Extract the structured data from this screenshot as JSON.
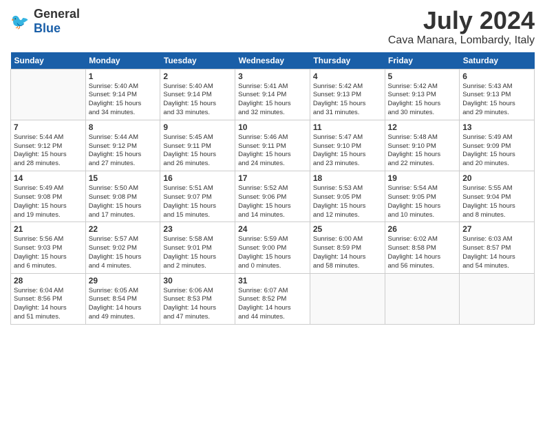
{
  "logo": {
    "general": "General",
    "blue": "Blue"
  },
  "title": {
    "month_year": "July 2024",
    "location": "Cava Manara, Lombardy, Italy"
  },
  "days_of_week": [
    "Sunday",
    "Monday",
    "Tuesday",
    "Wednesday",
    "Thursday",
    "Friday",
    "Saturday"
  ],
  "weeks": [
    [
      {
        "day": "",
        "info": ""
      },
      {
        "day": "1",
        "info": "Sunrise: 5:40 AM\nSunset: 9:14 PM\nDaylight: 15 hours\nand 34 minutes."
      },
      {
        "day": "2",
        "info": "Sunrise: 5:40 AM\nSunset: 9:14 PM\nDaylight: 15 hours\nand 33 minutes."
      },
      {
        "day": "3",
        "info": "Sunrise: 5:41 AM\nSunset: 9:14 PM\nDaylight: 15 hours\nand 32 minutes."
      },
      {
        "day": "4",
        "info": "Sunrise: 5:42 AM\nSunset: 9:13 PM\nDaylight: 15 hours\nand 31 minutes."
      },
      {
        "day": "5",
        "info": "Sunrise: 5:42 AM\nSunset: 9:13 PM\nDaylight: 15 hours\nand 30 minutes."
      },
      {
        "day": "6",
        "info": "Sunrise: 5:43 AM\nSunset: 9:13 PM\nDaylight: 15 hours\nand 29 minutes."
      }
    ],
    [
      {
        "day": "7",
        "info": "Sunrise: 5:44 AM\nSunset: 9:12 PM\nDaylight: 15 hours\nand 28 minutes."
      },
      {
        "day": "8",
        "info": "Sunrise: 5:44 AM\nSunset: 9:12 PM\nDaylight: 15 hours\nand 27 minutes."
      },
      {
        "day": "9",
        "info": "Sunrise: 5:45 AM\nSunset: 9:11 PM\nDaylight: 15 hours\nand 26 minutes."
      },
      {
        "day": "10",
        "info": "Sunrise: 5:46 AM\nSunset: 9:11 PM\nDaylight: 15 hours\nand 24 minutes."
      },
      {
        "day": "11",
        "info": "Sunrise: 5:47 AM\nSunset: 9:10 PM\nDaylight: 15 hours\nand 23 minutes."
      },
      {
        "day": "12",
        "info": "Sunrise: 5:48 AM\nSunset: 9:10 PM\nDaylight: 15 hours\nand 22 minutes."
      },
      {
        "day": "13",
        "info": "Sunrise: 5:49 AM\nSunset: 9:09 PM\nDaylight: 15 hours\nand 20 minutes."
      }
    ],
    [
      {
        "day": "14",
        "info": "Sunrise: 5:49 AM\nSunset: 9:08 PM\nDaylight: 15 hours\nand 19 minutes."
      },
      {
        "day": "15",
        "info": "Sunrise: 5:50 AM\nSunset: 9:08 PM\nDaylight: 15 hours\nand 17 minutes."
      },
      {
        "day": "16",
        "info": "Sunrise: 5:51 AM\nSunset: 9:07 PM\nDaylight: 15 hours\nand 15 minutes."
      },
      {
        "day": "17",
        "info": "Sunrise: 5:52 AM\nSunset: 9:06 PM\nDaylight: 15 hours\nand 14 minutes."
      },
      {
        "day": "18",
        "info": "Sunrise: 5:53 AM\nSunset: 9:05 PM\nDaylight: 15 hours\nand 12 minutes."
      },
      {
        "day": "19",
        "info": "Sunrise: 5:54 AM\nSunset: 9:05 PM\nDaylight: 15 hours\nand 10 minutes."
      },
      {
        "day": "20",
        "info": "Sunrise: 5:55 AM\nSunset: 9:04 PM\nDaylight: 15 hours\nand 8 minutes."
      }
    ],
    [
      {
        "day": "21",
        "info": "Sunrise: 5:56 AM\nSunset: 9:03 PM\nDaylight: 15 hours\nand 6 minutes."
      },
      {
        "day": "22",
        "info": "Sunrise: 5:57 AM\nSunset: 9:02 PM\nDaylight: 15 hours\nand 4 minutes."
      },
      {
        "day": "23",
        "info": "Sunrise: 5:58 AM\nSunset: 9:01 PM\nDaylight: 15 hours\nand 2 minutes."
      },
      {
        "day": "24",
        "info": "Sunrise: 5:59 AM\nSunset: 9:00 PM\nDaylight: 15 hours\nand 0 minutes."
      },
      {
        "day": "25",
        "info": "Sunrise: 6:00 AM\nSunset: 8:59 PM\nDaylight: 14 hours\nand 58 minutes."
      },
      {
        "day": "26",
        "info": "Sunrise: 6:02 AM\nSunset: 8:58 PM\nDaylight: 14 hours\nand 56 minutes."
      },
      {
        "day": "27",
        "info": "Sunrise: 6:03 AM\nSunset: 8:57 PM\nDaylight: 14 hours\nand 54 minutes."
      }
    ],
    [
      {
        "day": "28",
        "info": "Sunrise: 6:04 AM\nSunset: 8:56 PM\nDaylight: 14 hours\nand 51 minutes."
      },
      {
        "day": "29",
        "info": "Sunrise: 6:05 AM\nSunset: 8:54 PM\nDaylight: 14 hours\nand 49 minutes."
      },
      {
        "day": "30",
        "info": "Sunrise: 6:06 AM\nSunset: 8:53 PM\nDaylight: 14 hours\nand 47 minutes."
      },
      {
        "day": "31",
        "info": "Sunrise: 6:07 AM\nSunset: 8:52 PM\nDaylight: 14 hours\nand 44 minutes."
      },
      {
        "day": "",
        "info": ""
      },
      {
        "day": "",
        "info": ""
      },
      {
        "day": "",
        "info": ""
      }
    ]
  ]
}
